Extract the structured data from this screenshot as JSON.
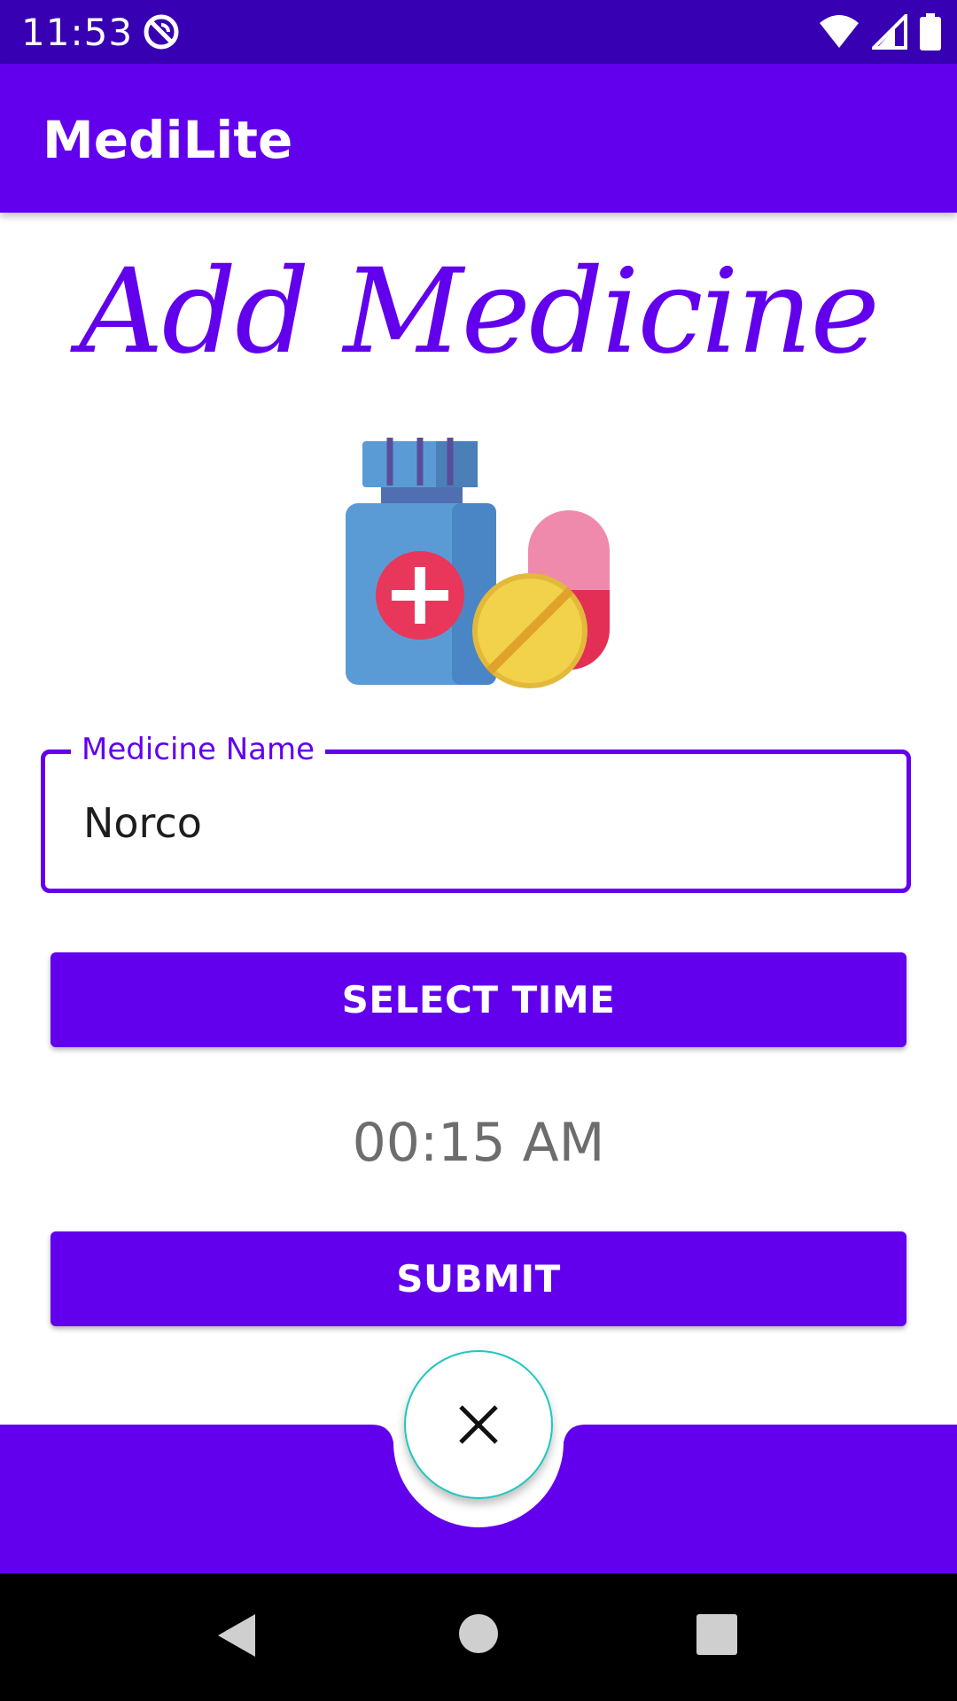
{
  "status_bar": {
    "time": "11:53",
    "icons": [
      "app-notification-icon",
      "wifi-icon",
      "cell-signal-icon",
      "battery-icon"
    ]
  },
  "app_bar": {
    "title": "MediLite"
  },
  "page": {
    "heading": "Add Medicine",
    "illustration": "medicine-bottle-and-pills-icon"
  },
  "form": {
    "medicine_name_label": "Medicine Name",
    "medicine_name_value": "Norco",
    "select_time_label": "SELECT TIME",
    "selected_time": "00:15 AM",
    "submit_label": "SUBMIT"
  },
  "bottom_bar": {
    "fab_icon": "close-icon"
  },
  "nav_bar": {
    "buttons": [
      "back-icon",
      "home-icon",
      "recents-icon"
    ]
  },
  "colors": {
    "primary": "#6200EE",
    "status_bar": "#3700B3",
    "fab_border": "#1ec8c0",
    "time_text": "#6d6d6d"
  }
}
